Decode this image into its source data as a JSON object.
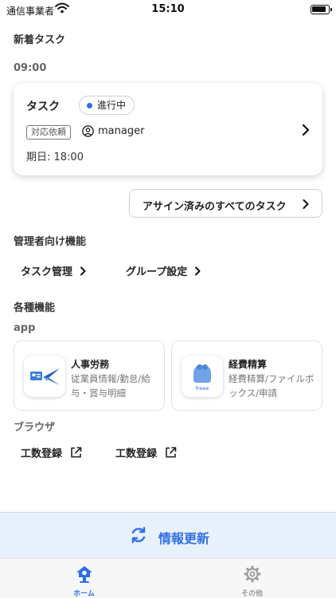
{
  "status_bar": {
    "carrier": "通信事業者",
    "time": "15:10"
  },
  "new_tasks": {
    "title": "新着タスク",
    "time_heading": "09:00",
    "card": {
      "name": "タスク",
      "status": "進行中",
      "type": "対応依頼",
      "assignee": "manager",
      "deadline": "期日: 18:00"
    },
    "all_tasks_label": "アサイン済みのすべてのタスク"
  },
  "admin": {
    "title": "管理者向け機能",
    "task_management": "タスク管理",
    "group_settings": "グループ設定"
  },
  "features": {
    "title": "各種機能",
    "app_heading": "app",
    "apps": [
      {
        "name": "人事労務",
        "desc": "従業員情報/勤怠/給与・賞与明細"
      },
      {
        "name": "経費精算",
        "desc": "経費精算/ファイルボックス/申請"
      }
    ],
    "browser_heading": "ブラウザ",
    "browser_links": [
      "工数登録",
      "工数登録"
    ]
  },
  "refresh_label": "情報更新",
  "tabs": [
    {
      "label": "ホーム",
      "icon": "home-icon",
      "active": true
    },
    {
      "label": "その他",
      "icon": "gear-icon",
      "active": false
    }
  ],
  "colors": {
    "accent": "#2f6fe4",
    "text": "#222222",
    "muted": "#777777",
    "refresh_bg": "#e8f0fb"
  }
}
